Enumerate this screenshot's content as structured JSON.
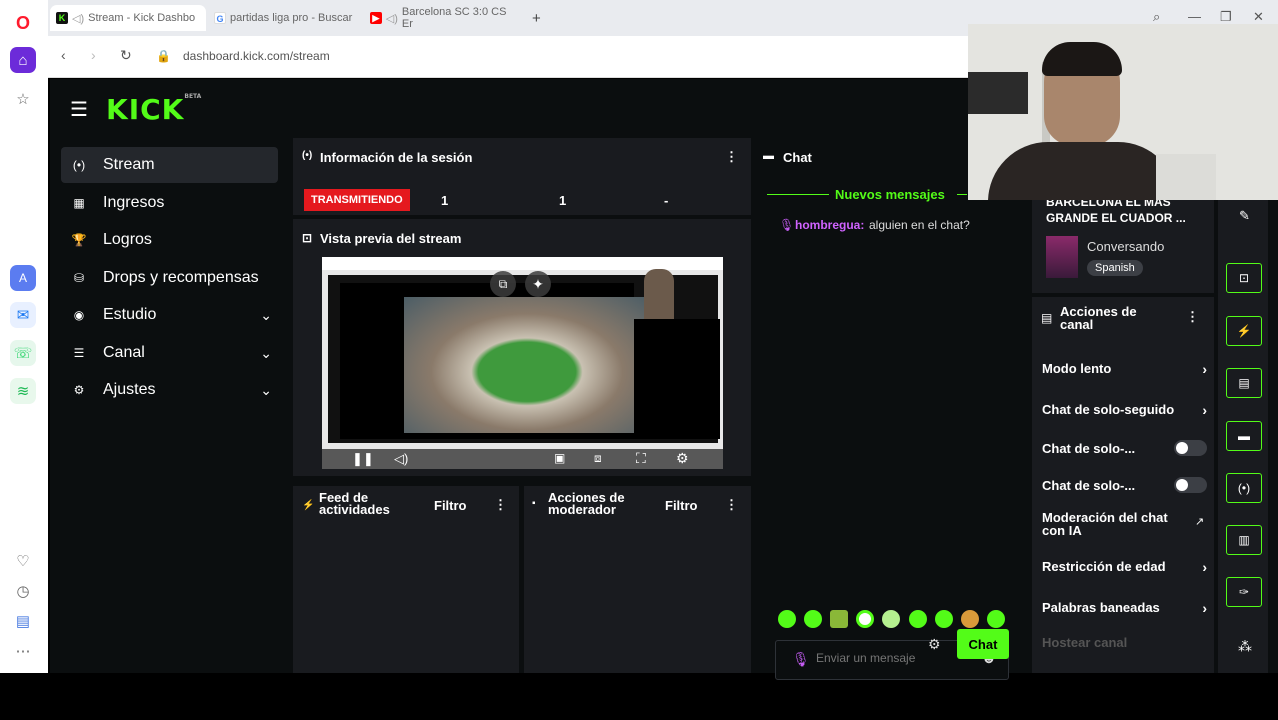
{
  "browser": {
    "tabs": [
      {
        "title": "Stream - Kick Dashbo",
        "active": true
      },
      {
        "title": "partidas liga pro - Buscar",
        "active": false
      },
      {
        "title": "Barcelona SC 3:0 CS Er",
        "active": false
      }
    ],
    "new_tab": "+",
    "url": "dashboard.kick.com/stream"
  },
  "kick": {
    "logo": "KICK",
    "logo_sup": "BETA",
    "menu": [
      {
        "label": "Stream",
        "icon": "(•)"
      },
      {
        "label": "Ingresos",
        "icon": "▦"
      },
      {
        "label": "Logros",
        "icon": "🏆"
      },
      {
        "label": "Drops y recompensas",
        "icon": "⛁"
      },
      {
        "label": "Estudio",
        "icon": "◉"
      },
      {
        "label": "Canal",
        "icon": "☰"
      },
      {
        "label": "Ajustes",
        "icon": "⚙"
      }
    ],
    "session": {
      "title": "Información de la sesión",
      "status": "TRANSMITIENDO",
      "stat1": "1",
      "stat2": "1",
      "stat3": "-"
    },
    "preview_title": "Vista previa del stream",
    "activity": {
      "title": "Feed de actividades",
      "filter": "Filtro"
    },
    "moderator": {
      "title": "Acciones de moderador",
      "filter": "Filtro"
    },
    "chat": {
      "title": "Chat",
      "new_messages": "Nuevos mensajes",
      "message_user": "hombregua:",
      "message_text": "alguien en el chat?",
      "placeholder": "Enviar un mensaje",
      "send": "Chat"
    },
    "stream_info": {
      "title": "BARCELONA EL MÁS GRANDE EL CUADOR ...",
      "category": "Conversando",
      "language": "Spanish"
    },
    "channel_actions": {
      "title": "Acciones de canal",
      "items": [
        "Modo lento",
        "Chat de solo-seguido",
        "Chat de solo-...",
        "Chat de solo-...",
        "Moderación del chat con IA",
        "Restricción de edad",
        "Palabras baneadas",
        "Hostear canal"
      ]
    }
  },
  "colors": {
    "accent": "#53fc18",
    "live": "#e5191e",
    "panel": "#191b1f",
    "bg": "#0b0e0f"
  }
}
